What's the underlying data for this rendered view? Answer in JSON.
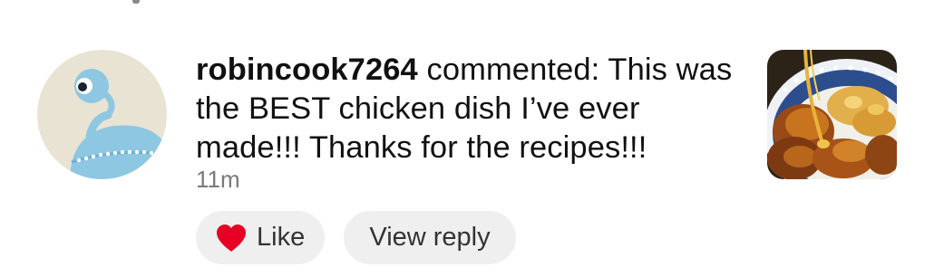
{
  "notification": {
    "username": "robincook7264",
    "action_text": " commented: This was the BEST chicken dish I’ve ever made!!! Thanks for the recipes!!!",
    "timestamp": "11m",
    "avatar_icon": "blue-alien-avatar-icon",
    "thumbnail_icon": "glazed-chicken-photo-thumbnail"
  },
  "actions": {
    "like_label": "Like",
    "like_icon": "heart-icon",
    "reply_label": "View reply"
  },
  "colors": {
    "heart": "#e60023",
    "pill_background": "#efefef",
    "timestamp": "#7a7a7a",
    "avatar_background": "#e9e3d3",
    "avatar_alien": "#8ec7e2"
  }
}
